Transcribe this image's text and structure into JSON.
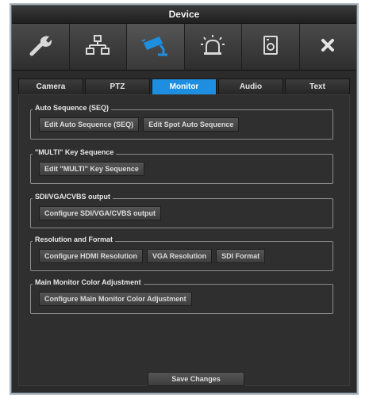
{
  "window": {
    "title": "Device"
  },
  "toolbar": {
    "icons": [
      "wrench-icon",
      "network-icon",
      "camera-icon",
      "alarm-light-icon",
      "disk-icon",
      "close-icon"
    ],
    "active_index": 2,
    "accent": "#1e8fe0"
  },
  "tabs": [
    {
      "label": "Camera"
    },
    {
      "label": "PTZ"
    },
    {
      "label": "Monitor",
      "active": true
    },
    {
      "label": "Audio"
    },
    {
      "label": "Text"
    }
  ],
  "groups": {
    "seq": {
      "title": "Auto Sequence (SEQ)",
      "buttons": [
        "Edit Auto Sequence (SEQ)",
        "Edit Spot Auto Sequence"
      ]
    },
    "multi": {
      "title": "\"MULTI\" Key Sequence",
      "buttons": [
        "Edit \"MULTI\" Key Sequence"
      ]
    },
    "output": {
      "title": "SDI/VGA/CVBS output",
      "buttons": [
        "Configure SDI/VGA/CVBS output"
      ]
    },
    "resolution": {
      "title": "Resolution and Format",
      "buttons": [
        "Configure HDMI Resolution",
        "VGA Resolution",
        "SDI Format"
      ]
    },
    "color": {
      "title": "Main Monitor Color Adjustment",
      "buttons": [
        "Configure Main Monitor Color Adjustment"
      ]
    }
  },
  "footer": {
    "save_label": "Save Changes"
  }
}
